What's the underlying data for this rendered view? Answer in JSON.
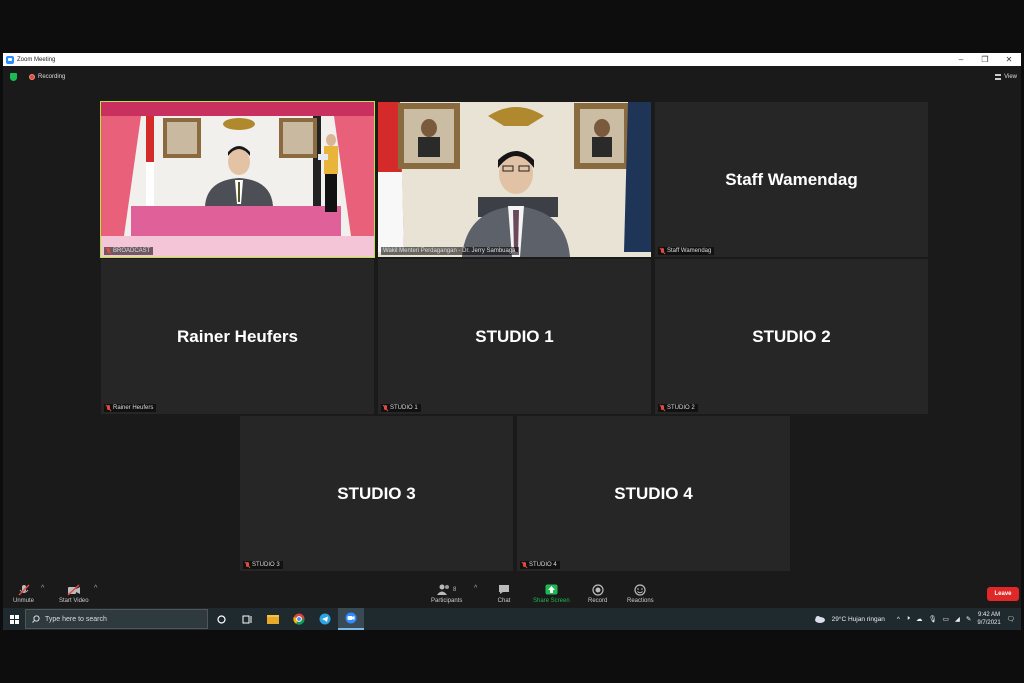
{
  "window": {
    "title": "Zoom Meeting",
    "controls": [
      "–",
      "❐",
      "✕"
    ]
  },
  "status": {
    "recording": "Recording",
    "view": "View"
  },
  "tiles": [
    {
      "label": "BROADCAST"
    },
    {
      "label": "Wakil Menteri Perdagangan - Dr. Jerry Sambuaga"
    },
    {
      "name": "Staff Wamendag",
      "label": "Staff Wamendag"
    },
    {
      "name": "Rainer Heufers",
      "label": "Rainer Heufers"
    },
    {
      "name": "STUDIO 1",
      "label": "STUDIO 1"
    },
    {
      "name": "STUDIO 2",
      "label": "STUDIO 2"
    },
    {
      "name": "STUDIO 3",
      "label": "STUDIO 3"
    },
    {
      "name": "STUDIO 4",
      "label": "STUDIO 4"
    }
  ],
  "controls": {
    "unmute": "Unmute",
    "start_video": "Start Video",
    "participants": "Participants",
    "participants_count": "8",
    "chat": "Chat",
    "share_screen": "Share Screen",
    "record": "Record",
    "reactions": "Reactions",
    "leave": "Leave",
    "share_color": "#1db954"
  },
  "taskbar": {
    "search_placeholder": "Type here to search",
    "weather": "29°C  Hujan ringan",
    "time": "9:42 AM",
    "date": "9/7/2021"
  }
}
